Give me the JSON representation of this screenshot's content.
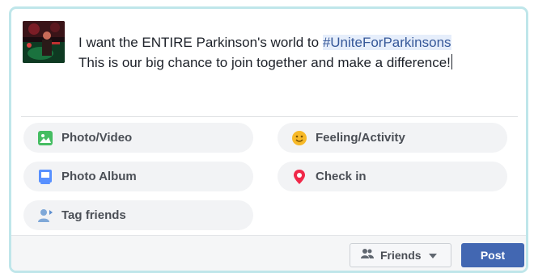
{
  "composer": {
    "text_part1": "I want the ENTIRE Parkinson's world to ",
    "hashtag": "#UniteForParkinsons",
    "text_part2": "This is our big chance to join together and make a difference!"
  },
  "options": [
    {
      "label": "Photo/Video",
      "icon": "photo-video-icon",
      "color": "#45bd62"
    },
    {
      "label": "Feeling/Activity",
      "icon": "smiley-icon",
      "color": "#f7b928"
    },
    {
      "label": "Photo Album",
      "icon": "photo-album-icon",
      "color": "#5890ff"
    },
    {
      "label": "Check in",
      "icon": "location-pin-icon",
      "color": "#f02849"
    },
    {
      "label": "Tag friends",
      "icon": "tag-friends-icon",
      "color": "#7fa8d8"
    }
  ],
  "footer": {
    "audience_label": "Friends",
    "post_label": "Post"
  },
  "colors": {
    "accent": "#4267b2",
    "border": "#bfe6ea"
  }
}
